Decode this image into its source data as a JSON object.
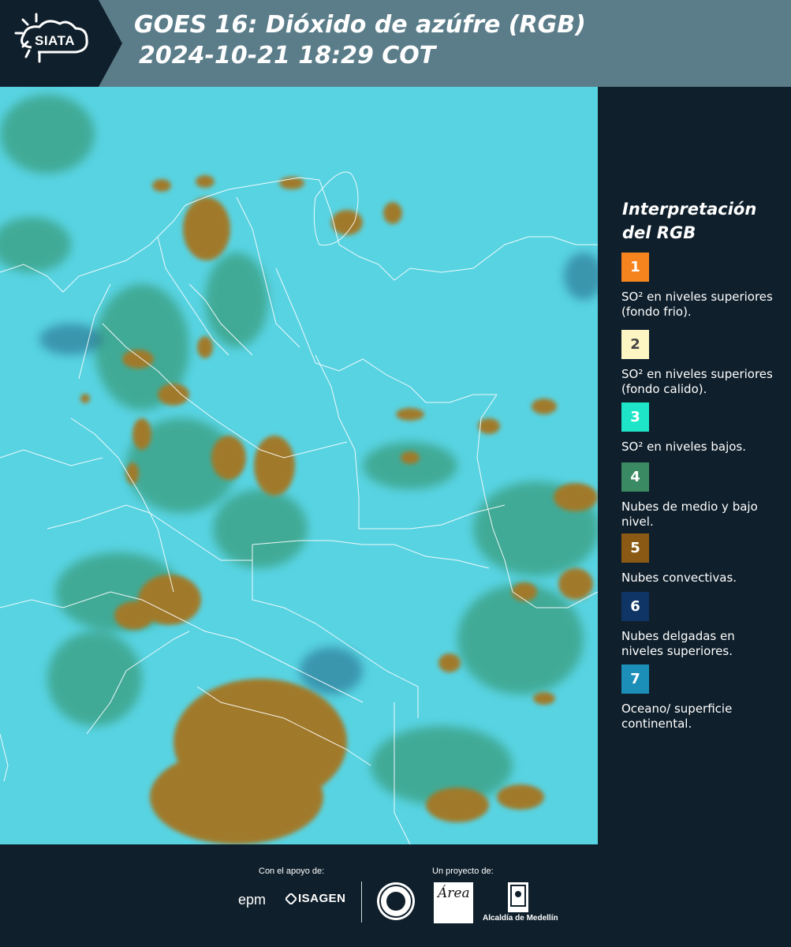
{
  "header": {
    "logo_text": "SIATA",
    "title_line1": "GOES 16: Dióxido de azúfre (RGB)",
    "title_line2": "2024-10-21 18:29 COT",
    "background_color": "#5b7d8a",
    "logo_background_color": "#0f1f2b"
  },
  "map": {
    "description_icon": "satellite-rgb-map",
    "base_color": "#54d1e0",
    "cloud_colors": {
      "convective": "#a07a2a",
      "mid_low": "#2e8a5a",
      "thin_high": "#1e5a7a"
    },
    "border_color": "#ffffff"
  },
  "legend": {
    "title": "Interpretación del RGB",
    "items": [
      {
        "number": "1",
        "label": "SO² en niveles superiores (fondo frio).",
        "color": "#f5841f",
        "text_color": "#ffffff"
      },
      {
        "number": "2",
        "label": "SO² en niveles superiores (fondo calido).",
        "color": "#fdf6c3",
        "text_color": "#444444"
      },
      {
        "number": "3",
        "label": "SO² en niveles bajos.",
        "color": "#1fe5c8",
        "text_color": "#ffffff"
      },
      {
        "number": "4",
        "label": "Nubes de medio y bajo nivel.",
        "color": "#3a8a63",
        "text_color": "#ffffff"
      },
      {
        "number": "5",
        "label": "Nubes convectivas.",
        "color": "#8a5a14",
        "text_color": "#ffffff"
      },
      {
        "number": "6",
        "label": "Nubes delgadas en niveles superiores.",
        "color": "#0f3566",
        "text_color": "#ffffff"
      },
      {
        "number": "7",
        "label": "Oceano/ superficie continental.",
        "color": "#1b8fb8",
        "text_color": "#ffffff"
      }
    ]
  },
  "footer": {
    "support_label": "Con el apoyo de:",
    "project_label": "Un proyecto de:",
    "epm": "epm",
    "isagen": "ISAGEN",
    "area_script": "Área",
    "alcaldia": "Alcaldía de Medellín"
  }
}
